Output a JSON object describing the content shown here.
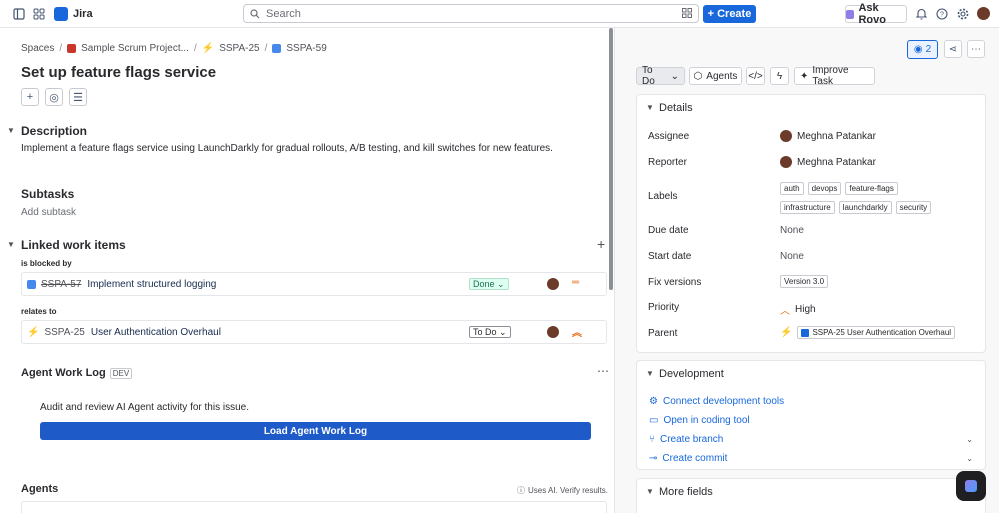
{
  "topbar": {
    "app_name": "Jira",
    "search_placeholder": "Search",
    "create_label": "Create",
    "rovo_label": "Ask Rovo"
  },
  "breadcrumb": {
    "spaces": "Spaces",
    "project": "Sample Scrum Project...",
    "epic": "SSPA-25",
    "issue": "SSPA-59"
  },
  "issue": {
    "title": "Set up feature flags service",
    "description_heading": "Description",
    "description": "Implement a feature flags service using LaunchDarkly for gradual rollouts, A/B testing, and kill switches for new features.",
    "subtasks_heading": "Subtasks",
    "add_subtask": "Add subtask",
    "linked_heading": "Linked work items",
    "link_groups": [
      {
        "relation": "is blocked by",
        "key": "SSPA-57",
        "summary": "Implement structured logging",
        "status": "Done"
      },
      {
        "relation": "relates to",
        "key": "SSPA-25",
        "summary": "User Authentication Overhaul",
        "status": "To Do"
      }
    ],
    "agent_log_heading": "Agent Work Log",
    "agent_log_badge": "DEV",
    "agent_log_text": "Audit and review AI Agent activity for this issue.",
    "agent_log_button": "Load Agent Work Log",
    "agents_heading": "Agents",
    "agents_note": "Uses AI. Verify results."
  },
  "sidebar": {
    "watchers": "2",
    "status": "To Do",
    "agents_btn": "Agents",
    "improve_btn": "Improve Task",
    "details_heading": "Details",
    "fields": {
      "assignee_label": "Assignee",
      "assignee": "Meghna Patankar",
      "reporter_label": "Reporter",
      "reporter": "Meghna Patankar",
      "labels_label": "Labels",
      "labels": [
        "auth",
        "devops",
        "feature-flags",
        "infrastructure",
        "launchdarkly",
        "security"
      ],
      "due_label": "Due date",
      "due": "None",
      "start_label": "Start date",
      "start": "None",
      "fix_label": "Fix versions",
      "fix": "Version 3.0",
      "priority_label": "Priority",
      "priority": "High",
      "parent_label": "Parent",
      "parent": "SSPA-25 User Authentication Overhaul"
    },
    "development_heading": "Development",
    "dev_links": [
      "Connect development tools",
      "Open in coding tool",
      "Create branch",
      "Create commit"
    ],
    "more_fields_heading": "More fields"
  },
  "colors": {
    "brand": "#1868db",
    "done_bg": "#dcfff1",
    "priority": "#e56910"
  }
}
